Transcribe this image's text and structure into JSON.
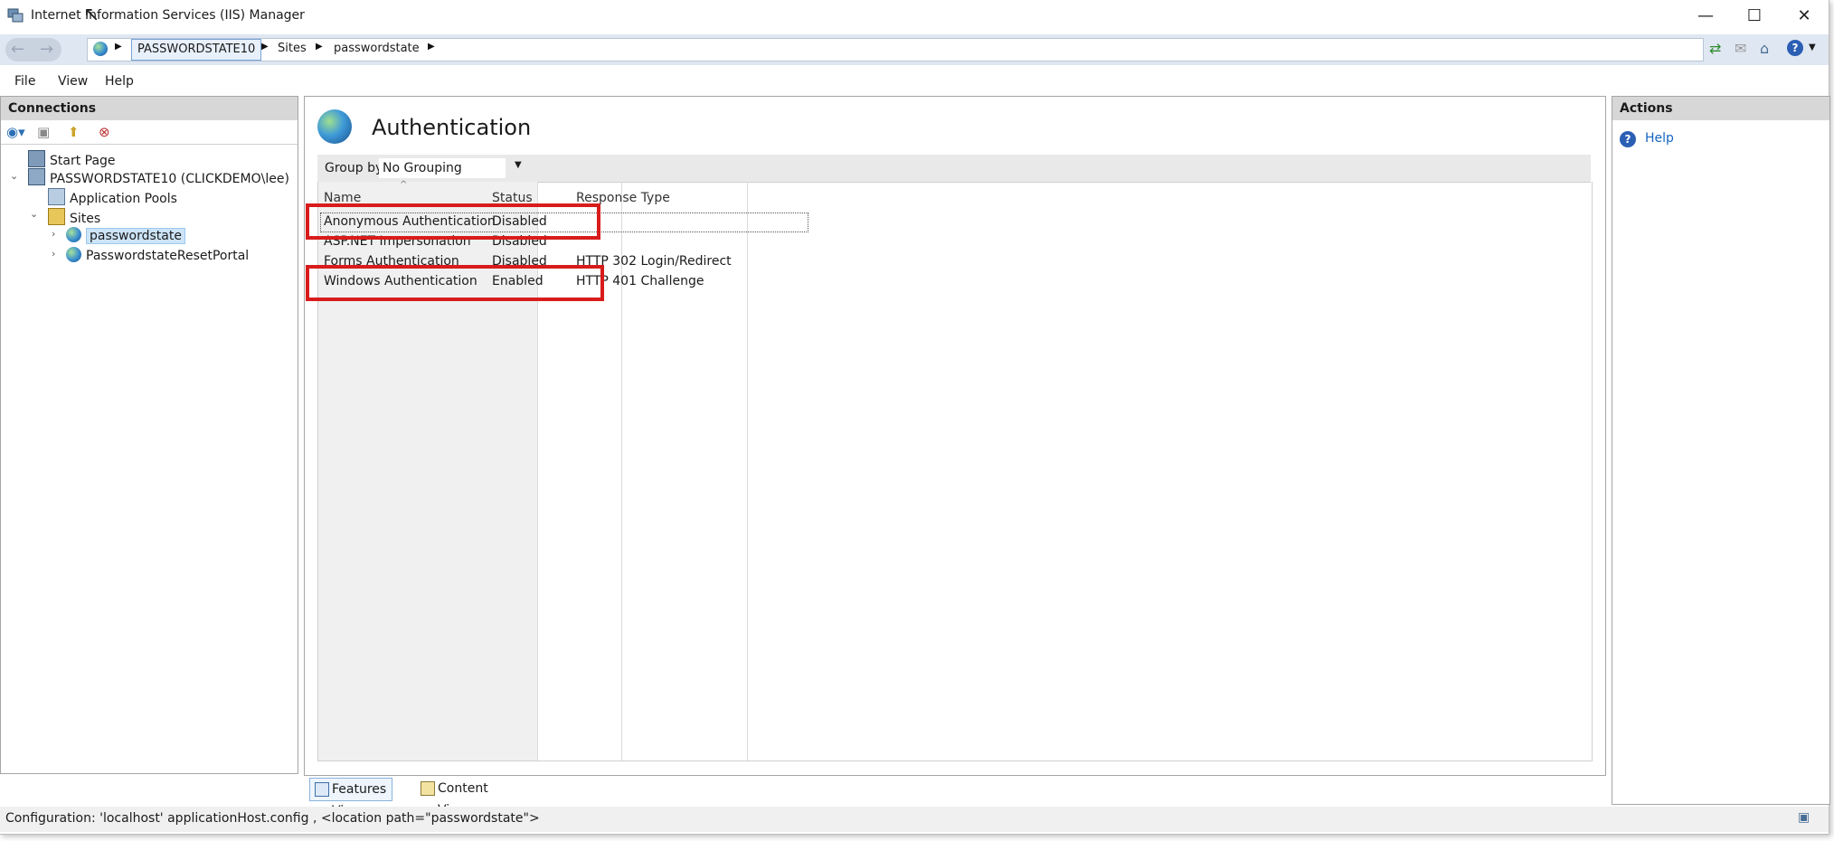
{
  "window": {
    "title": "Internet Information Services (IIS) Manager",
    "minimize": "—",
    "maximize": "☐",
    "close": "✕"
  },
  "address": {
    "crumbs": [
      "PASSWORDSTATE10",
      "Sites",
      "passwordstate"
    ],
    "back_icon": "back-arrow-icon",
    "forward_icon": "forward-arrow-icon"
  },
  "menu": {
    "items": [
      "File",
      "View",
      "Help"
    ]
  },
  "connections": {
    "title": "Connections",
    "tree": {
      "start_page": "Start Page",
      "server": "PASSWORDSTATE10 (CLICKDEMO\\lee)",
      "app_pools": "Application Pools",
      "sites": "Sites",
      "site1": "passwordstate",
      "site2": "PasswordstateResetPortal"
    }
  },
  "feature": {
    "title": "Authentication",
    "group_by_label": "Group by:",
    "group_by_value": "No Grouping",
    "columns": [
      "Name",
      "Status",
      "Response Type"
    ],
    "rows": [
      {
        "name": "Anonymous Authentication",
        "status": "Disabled",
        "response": ""
      },
      {
        "name": "ASP.NET Impersonation",
        "status": "Disabled",
        "response": ""
      },
      {
        "name": "Forms Authentication",
        "status": "Disabled",
        "response": "HTTP 302 Login/Redirect"
      },
      {
        "name": "Windows Authentication",
        "status": "Enabled",
        "response": "HTTP 401 Challenge"
      }
    ]
  },
  "view_tabs": {
    "features": "Features View",
    "content": "Content View"
  },
  "actions": {
    "title": "Actions",
    "help": "Help"
  },
  "status": {
    "text": "Configuration: 'localhost' applicationHost.config , <location path=\"passwordstate\">"
  },
  "colors": {
    "highlight": "#d81c1c",
    "selection": "#cce4f7",
    "link": "#1565c0"
  }
}
